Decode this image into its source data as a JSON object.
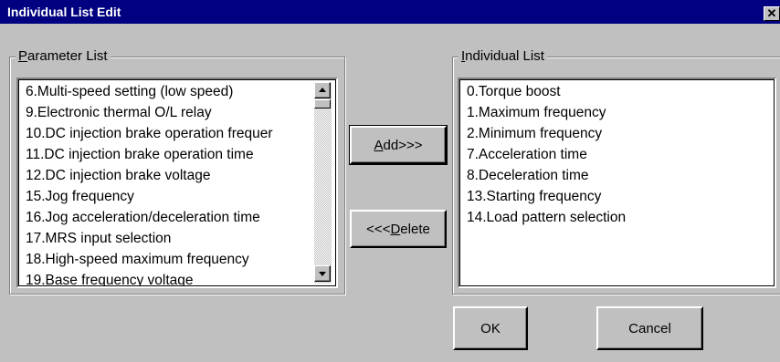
{
  "window": {
    "title": "Individual List Edit",
    "close_glyph": "✕"
  },
  "parameter_list": {
    "legend_accel": "P",
    "legend_rest": "arameter List",
    "items": [
      "6.Multi-speed setting (low speed)",
      "9.Electronic thermal O/L relay",
      "10.DC injection brake operation frequer",
      "11.DC injection brake operation time",
      "12.DC injection brake voltage",
      "15.Jog frequency",
      "16.Jog acceleration/deceleration time",
      "17.MRS input selection",
      "18.High-speed maximum frequency",
      "19.Base frequency voltage"
    ],
    "scroll": {
      "up_icon": "triangle-up",
      "down_icon": "triangle-down",
      "thumb_position": 0.05
    }
  },
  "individual_list": {
    "legend_accel": "I",
    "legend_rest": "ndividual List",
    "items": [
      "0.Torque boost",
      "1.Maximum frequency",
      "2.Minimum frequency",
      "7.Acceleration time",
      "8.Deceleration time",
      "13.Starting frequency",
      "14.Load pattern selection"
    ]
  },
  "buttons": {
    "add_accel": "A",
    "add_rest": "dd>>>",
    "delete_pre": "<<<",
    "delete_accel": "D",
    "delete_rest": "elete",
    "ok": "OK",
    "cancel": "Cancel"
  },
  "colors": {
    "titlebar": "#000080",
    "face": "#c0c0c0",
    "list_bg": "#ffffff"
  }
}
